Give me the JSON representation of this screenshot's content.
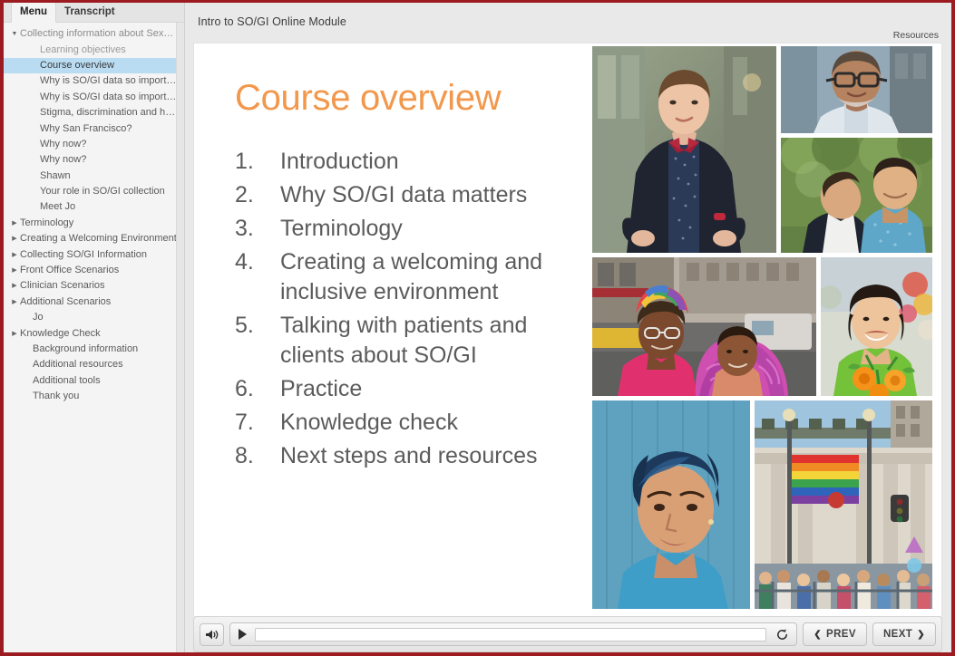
{
  "frame": {
    "accent_border": "#9c1b20"
  },
  "sidebar": {
    "tabs": [
      {
        "label": "Menu",
        "active": true
      },
      {
        "label": "Transcript",
        "active": false
      }
    ],
    "items": [
      {
        "label": "Collecting information about Sexual...",
        "level": "lvl0",
        "arrow": "▼",
        "selected": false
      },
      {
        "label": "Learning objectives",
        "level": "lvl1 dim",
        "arrow": "",
        "selected": false
      },
      {
        "label": "Course overview",
        "level": "lvl1",
        "arrow": "",
        "selected": true
      },
      {
        "label": "Why is SO/GI data so important?",
        "level": "lvl1",
        "arrow": "",
        "selected": false
      },
      {
        "label": "Why is SO/GI data so important?",
        "level": "lvl1",
        "arrow": "",
        "selected": false
      },
      {
        "label": "Stigma, discrimination and health",
        "level": "lvl1",
        "arrow": "",
        "selected": false
      },
      {
        "label": "Why San Francisco?",
        "level": "lvl1",
        "arrow": "",
        "selected": false
      },
      {
        "label": "Why now?",
        "level": "lvl1",
        "arrow": "",
        "selected": false
      },
      {
        "label": "Why now?",
        "level": "lvl1",
        "arrow": "",
        "selected": false
      },
      {
        "label": "Shawn",
        "level": "lvl1",
        "arrow": "",
        "selected": false
      },
      {
        "label": "Your role in SO/GI collection",
        "level": "lvl1",
        "arrow": "",
        "selected": false
      },
      {
        "label": "Meet Jo",
        "level": "lvl1",
        "arrow": "",
        "selected": false
      },
      {
        "label": "Terminology",
        "level": "group",
        "arrow": "▶",
        "selected": false
      },
      {
        "label": "Creating a Welcoming Environment",
        "level": "group",
        "arrow": "▶",
        "selected": false
      },
      {
        "label": "Collecting SO/GI Information",
        "level": "group",
        "arrow": "▶",
        "selected": false
      },
      {
        "label": "Front Office Scenarios",
        "level": "group",
        "arrow": "▶",
        "selected": false
      },
      {
        "label": "Clinician Scenarios",
        "level": "group",
        "arrow": "▶",
        "selected": false
      },
      {
        "label": "Additional Scenarios",
        "level": "group",
        "arrow": "▶",
        "selected": false
      },
      {
        "label": "Jo",
        "level": "plain",
        "arrow": "",
        "selected": false
      },
      {
        "label": "Knowledge Check",
        "level": "group",
        "arrow": "▶",
        "selected": false
      },
      {
        "label": "Background information",
        "level": "plain",
        "arrow": "",
        "selected": false
      },
      {
        "label": "Additional resources",
        "level": "plain",
        "arrow": "",
        "selected": false
      },
      {
        "label": "Additional tools",
        "level": "plain",
        "arrow": "",
        "selected": false
      },
      {
        "label": "Thank you",
        "level": "plain",
        "arrow": "",
        "selected": false
      }
    ]
  },
  "header": {
    "title": "Intro to SO/GI Online Module",
    "resources_label": "Resources"
  },
  "slide": {
    "title": "Course overview",
    "title_color": "#f2984c",
    "items": [
      {
        "num": "1.",
        "text": "Introduction"
      },
      {
        "num": "2.",
        "text": "Why SO/GI data matters"
      },
      {
        "num": "3.",
        "text": "Terminology"
      },
      {
        "num": "4.",
        "text": "Creating a welcoming and inclusive environment"
      },
      {
        "num": "5.",
        "text": "Talking with patients and clients about SO/GI"
      },
      {
        "num": "6.",
        "text": "Practice"
      },
      {
        "num": "7.",
        "text": "Knowledge check"
      },
      {
        "num": "8.",
        "text": "Next steps and resources"
      }
    ],
    "photos": [
      {
        "name": "photo-person-bowtie-street"
      },
      {
        "name": "photo-man-glasses-portrait"
      },
      {
        "name": "photo-couple-park-embrace"
      },
      {
        "name": "photo-two-women-colorful-hair"
      },
      {
        "name": "photo-woman-green-shirt-flowers"
      },
      {
        "name": "photo-woman-blue-hair"
      },
      {
        "name": "photo-pride-flag-parade"
      }
    ]
  },
  "player": {
    "volume_icon": "speaker-icon",
    "play_icon": "play-icon",
    "replay_icon": "replay-icon",
    "prev_label": "PREV",
    "next_label": "NEXT",
    "prev_chevron": "❮",
    "next_chevron": "❯",
    "seek_progress": 0
  }
}
